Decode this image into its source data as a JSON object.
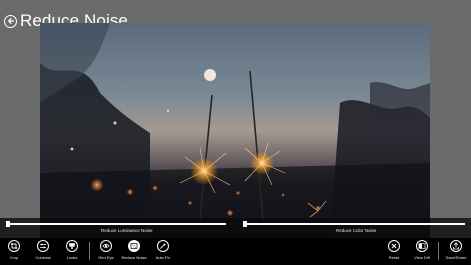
{
  "header": {
    "title": "Reduce Noise"
  },
  "sliders": {
    "luminance": {
      "label": "Reduce Luminance Noise",
      "value": 0
    },
    "color": {
      "label": "Reduce Color Noise",
      "value": 0
    }
  },
  "toolbar": {
    "crop": "Crop",
    "contrast": "Contrast",
    "looks": "Looks",
    "red_eye": "Red Eye",
    "reduce_noise": "Reduce Noise",
    "auto_fix": "Auto Fix",
    "reset": "Reset",
    "view_diff": "View Diff",
    "save_share": "Save/Share",
    "active_tool": "reduce_noise"
  }
}
